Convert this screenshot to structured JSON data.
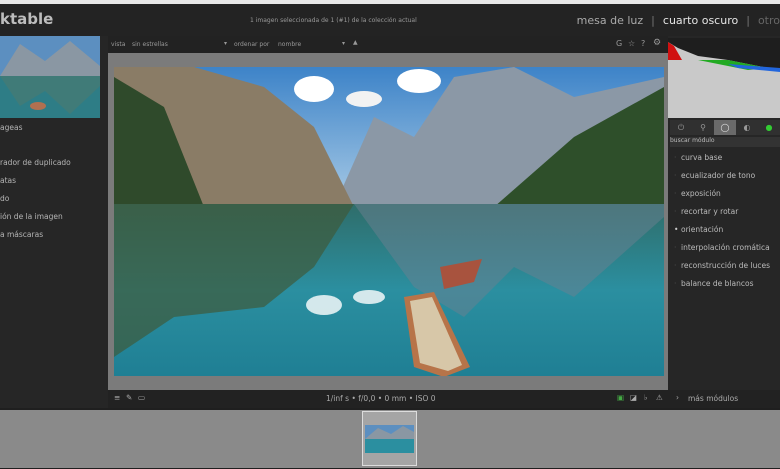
{
  "header": {
    "logo": "ktable",
    "status": "1 imagen seleccionada de 1 (#1) de la colección actual",
    "views": [
      {
        "label": "mesa de luz"
      },
      {
        "label": "cuarto oscuro",
        "active": true
      },
      {
        "label": "otro"
      }
    ]
  },
  "left_panel": {
    "items": [
      "ageas",
      "",
      "rador de duplicado",
      "atas",
      "do",
      "ión de la imagen",
      "a máscaras"
    ]
  },
  "toolbar": {
    "view_label": "vista",
    "view_value": "sin estrellas",
    "sort_label": "ordenar por",
    "sort_value": "nombre",
    "icons": [
      "grouping-icon",
      "star-icon",
      "help-icon",
      "gear-icon"
    ]
  },
  "right_panel": {
    "tabs": [
      "power-icon",
      "favorites-icon",
      "active-icon",
      "base-icon",
      "color-icon"
    ],
    "search_placeholder": "buscar módulo",
    "modules": [
      {
        "label": "curva base"
      },
      {
        "label": "ecualizador de tono"
      },
      {
        "label": "exposición"
      },
      {
        "label": "recortar y rotar"
      },
      {
        "label": "orientación",
        "active": true
      },
      {
        "label": "interpolación cromática"
      },
      {
        "label": "reconstrucción de luces"
      },
      {
        "label": "balance de blancos"
      }
    ],
    "more_modules": "más módulos"
  },
  "bottom": {
    "exif": "1/inf s • f/0,0 • 0 mm • ISO 0"
  },
  "colors": {
    "accent": "#e6e6e6",
    "panel": "#262626",
    "canvas": "#7b7b7b"
  }
}
